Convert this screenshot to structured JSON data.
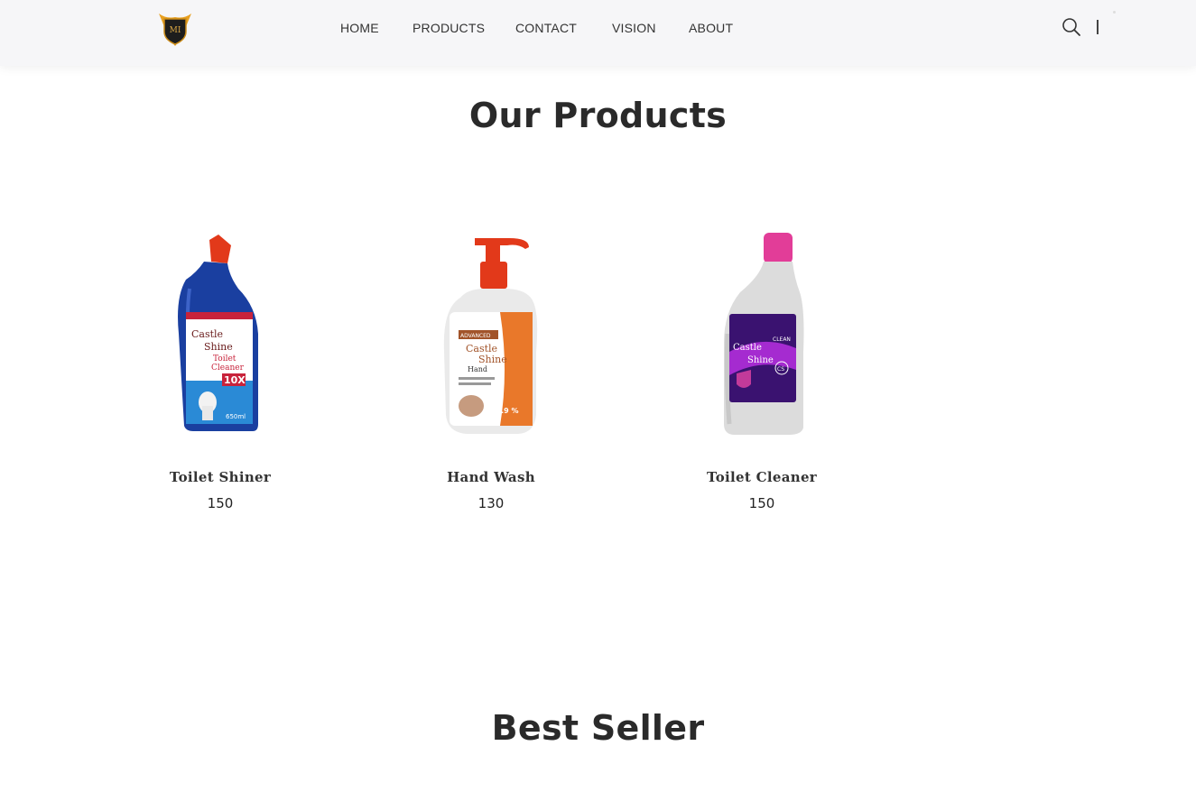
{
  "nav": {
    "links": [
      "HOME",
      "PRODUCTS",
      "CONTACT",
      "VISION",
      "ABOUT"
    ],
    "logo_text": "MI"
  },
  "products_section": {
    "title": "Our Products",
    "items": [
      {
        "name": "Toilet Shiner",
        "price": "150",
        "icon": "toilet-shiner-bottle-image",
        "label_text": [
          "Castle",
          "Shine",
          "Toilet",
          "Cleaner",
          "10X",
          "650ml"
        ],
        "accent": "#1a3fa0"
      },
      {
        "name": "Hand Wash",
        "price": "130",
        "icon": "hand-wash-bottle-image",
        "label_text": [
          "ADVANCED",
          "Castle",
          "Shine",
          "Hand",
          "99.9 %"
        ],
        "accent": "#e06d22"
      },
      {
        "name": "Toilet Cleaner",
        "price": "150",
        "icon": "toilet-cleaner-bottle-image",
        "label_text": [
          "Castle",
          "Shine",
          "CLEAN",
          "CS"
        ],
        "accent": "#6a1fb0"
      }
    ]
  },
  "best_seller_section": {
    "title": "Best Seller"
  },
  "colors": {
    "navbar_bg": "#f6f6f8",
    "heading": "#2a2a2a",
    "text": "#333333",
    "cap_red": "#e2391a",
    "cap_pink": "#e23d98"
  }
}
